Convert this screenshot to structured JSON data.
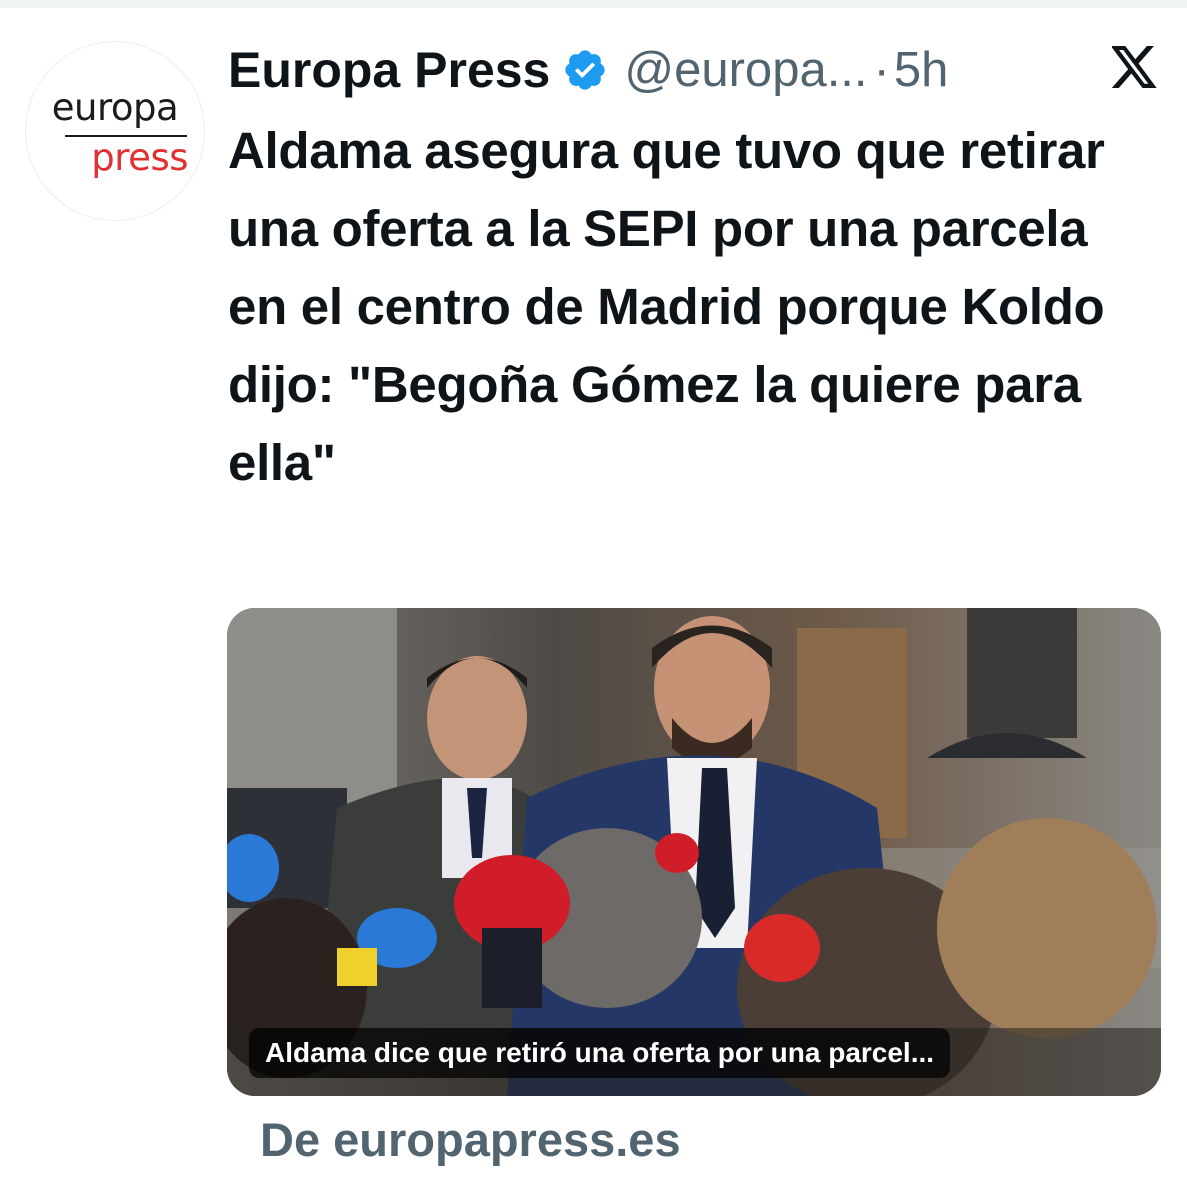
{
  "tweet": {
    "author": {
      "name": "Europa Press",
      "handle": "@europa...",
      "verified": true,
      "avatar_logo_top": "europa",
      "avatar_logo_bottom": "press"
    },
    "separator": "·",
    "time": "5h",
    "platform_icon": "x-logo-icon",
    "text": "Aldama asegura que tuvo que retirar una oferta a la SEPI por una parcela en el centro de Madrid porque Koldo dijo: \"Begoña Gómez la quiere para ella\"",
    "card": {
      "caption": "Aldama dice que retiró una oferta por una parcel...",
      "source": "De europapress.es"
    }
  },
  "colors": {
    "text_primary": "#0f1419",
    "text_secondary": "#536471",
    "verified_blue": "#1d9bf0",
    "logo_red": "#e03033"
  }
}
